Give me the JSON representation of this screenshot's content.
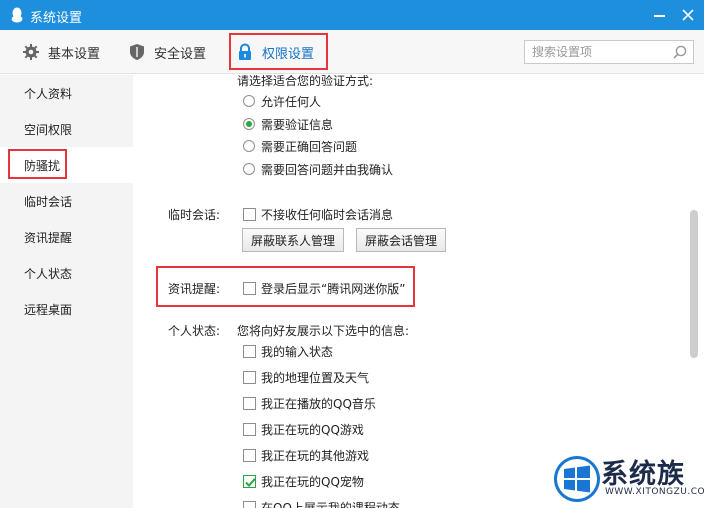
{
  "window": {
    "title": "系统设置"
  },
  "tabs": [
    {
      "label": "基本设置",
      "icon": "gear-icon"
    },
    {
      "label": "安全设置",
      "icon": "shield-icon"
    },
    {
      "label": "权限设置",
      "icon": "lock-icon",
      "active": true
    }
  ],
  "search": {
    "placeholder": "搜索设置项"
  },
  "sidebar": {
    "items": [
      {
        "label": "个人资料"
      },
      {
        "label": "空间权限"
      },
      {
        "label": "防骚扰",
        "active": true
      },
      {
        "label": "临时会话"
      },
      {
        "label": "资讯提醒"
      },
      {
        "label": "个人状态"
      },
      {
        "label": "远程桌面"
      }
    ]
  },
  "verify": {
    "prompt": "请选择适合您的验证方式:",
    "options": [
      {
        "label": "允许任何人",
        "checked": false
      },
      {
        "label": "需要验证信息",
        "checked": true
      },
      {
        "label": "需要正确回答问题",
        "checked": false
      },
      {
        "label": "需要回答问题并由我确认",
        "checked": false
      }
    ]
  },
  "temp_session": {
    "label": "临时会话:",
    "checkbox": {
      "label": "不接收任何临时会话消息",
      "checked": false
    },
    "buttons": [
      "屏蔽联系人管理",
      "屏蔽会话管理"
    ]
  },
  "news": {
    "label": "资讯提醒:",
    "checkbox": {
      "label": "登录后显示“腾讯网迷你版”",
      "checked": false
    }
  },
  "personal_status": {
    "label": "个人状态:",
    "prompt": "您将向好友展示以下选中的信息:",
    "items": [
      {
        "label": "我的输入状态",
        "checked": false
      },
      {
        "label": "我的地理位置及天气",
        "checked": false
      },
      {
        "label": "我正在播放的QQ音乐",
        "checked": false
      },
      {
        "label": "我正在玩的QQ游戏",
        "checked": false
      },
      {
        "label": "我正在玩的其他游戏",
        "checked": false
      },
      {
        "label": "我正在玩的QQ宠物",
        "checked": true
      },
      {
        "label": "在QQ上展示我的课程动态",
        "checked": false
      }
    ]
  },
  "watermark": {
    "text": "系统族",
    "url": "WWW.XITONGZU.COM"
  },
  "colors": {
    "titlebar": "#1e8fdd",
    "highlight": "#e8353d",
    "check": "#27a844"
  }
}
